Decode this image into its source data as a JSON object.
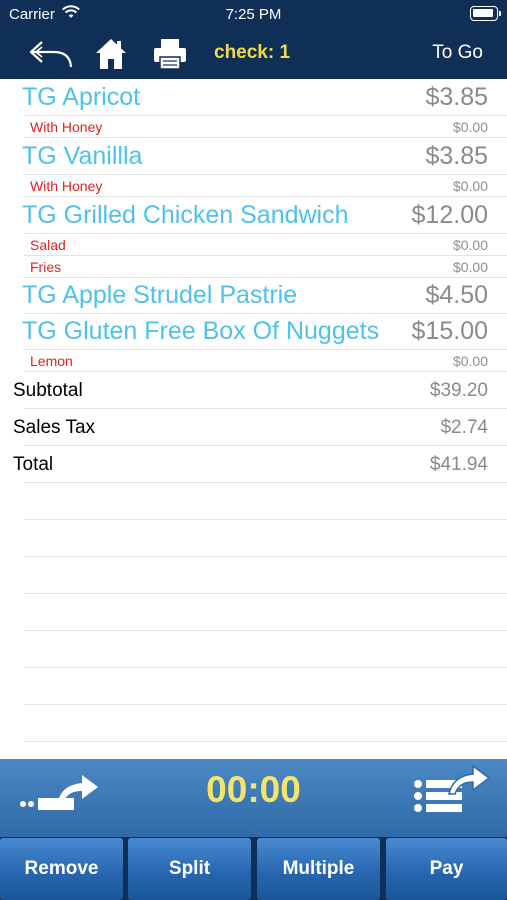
{
  "status": {
    "carrier": "Carrier",
    "time": "7:25 PM"
  },
  "nav": {
    "check": "check: 1",
    "togo": "To Go"
  },
  "items": [
    {
      "name": "TG Apricot",
      "price": "$3.85",
      "modifiers": [
        {
          "name": "With Honey",
          "price": "$0.00"
        }
      ]
    },
    {
      "name": "TG Vanillla",
      "price": "$3.85",
      "modifiers": [
        {
          "name": "With Honey",
          "price": "$0.00"
        }
      ]
    },
    {
      "name": "TG Grilled Chicken Sandwich",
      "price": "$12.00",
      "modifiers": [
        {
          "name": "Salad",
          "price": "$0.00"
        },
        {
          "name": "Fries",
          "price": "$0.00"
        }
      ]
    },
    {
      "name": "TG Apple Strudel Pastrie",
      "price": "$4.50",
      "modifiers": []
    },
    {
      "name": "TG Gluten Free Box Of Nuggets",
      "price": "$15.00",
      "modifiers": [
        {
          "name": "Lemon",
          "price": "$0.00"
        }
      ]
    }
  ],
  "summary": {
    "subtotal_label": "Subtotal",
    "subtotal": "$39.20",
    "tax_label": "Sales Tax",
    "tax": "$2.74",
    "total_label": "Total",
    "total": "$41.94"
  },
  "timer": "00:00",
  "buttons": {
    "remove": "Remove",
    "split": "Split",
    "multiple": "Multiple",
    "pay": "Pay"
  },
  "colors": {
    "header": "#0f2f57",
    "item_text": "#4fc2ea",
    "modifier_text": "#e0231c",
    "accent_yellow": "#f3d94a"
  }
}
